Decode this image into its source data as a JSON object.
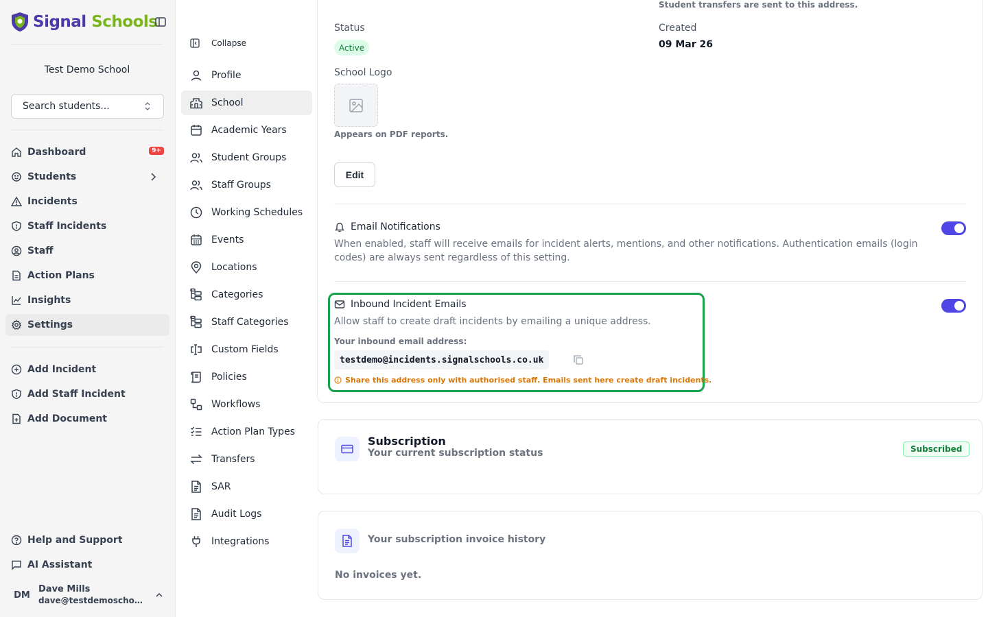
{
  "brand": {
    "name_part1": "Signal",
    "name_part2": " Schools",
    "primary": "#4b3ba8",
    "secondary": "#7ab51d"
  },
  "sidebar": {
    "school_name": "Test Demo School",
    "search_placeholder": "Search students...",
    "main_items": [
      {
        "label": "Dashboard",
        "icon": "home-icon",
        "badge": "9+"
      },
      {
        "label": "Students",
        "icon": "smile-icon"
      },
      {
        "label": "Incidents",
        "icon": "warning-triangle-icon"
      },
      {
        "label": "Staff Incidents",
        "icon": "shield-icon"
      },
      {
        "label": "Staff",
        "icon": "user-circle-icon"
      },
      {
        "label": "Action Plans",
        "icon": "document-icon"
      },
      {
        "label": "Insights",
        "icon": "line-chart-icon"
      },
      {
        "label": "Settings",
        "icon": "gear-icon",
        "active": true
      }
    ],
    "quick_items": [
      {
        "label": "Add Incident",
        "icon": "plus-circle-icon"
      },
      {
        "label": "Add Staff Incident",
        "icon": "shield-plus-icon"
      },
      {
        "label": "Add Document",
        "icon": "file-plus-icon"
      }
    ],
    "footer_items": [
      {
        "label": "Help and Support",
        "icon": "help-circle-icon"
      },
      {
        "label": "AI Assistant",
        "icon": "chat-bubble-icon"
      }
    ],
    "user": {
      "initials": "DM",
      "name": "Dave Mills",
      "email": "dave@testdemoschool.co.uk"
    }
  },
  "settings_nav": {
    "collapse_label": "Collapse",
    "items": [
      {
        "label": "Profile",
        "icon": "user-icon"
      },
      {
        "label": "School",
        "icon": "building-icon",
        "active": true
      },
      {
        "label": "Academic Years",
        "icon": "calendar-icon"
      },
      {
        "label": "Student Groups",
        "icon": "users-icon"
      },
      {
        "label": "Staff Groups",
        "icon": "users-cog-icon"
      },
      {
        "label": "Working Schedules",
        "icon": "clock-icon"
      },
      {
        "label": "Events",
        "icon": "calendar-days-icon"
      },
      {
        "label": "Locations",
        "icon": "map-pin-icon"
      },
      {
        "label": "Categories",
        "icon": "folder-tree-icon"
      },
      {
        "label": "Staff Categories",
        "icon": "folder-tree-icon"
      },
      {
        "label": "Custom Fields",
        "icon": "text-cursor-input-icon"
      },
      {
        "label": "Policies",
        "icon": "scroll-icon"
      },
      {
        "label": "Workflows",
        "icon": "workflow-icon"
      },
      {
        "label": "Action Plan Types",
        "icon": "list-checks-icon"
      },
      {
        "label": "Transfers",
        "icon": "arrows-left-right-icon"
      },
      {
        "label": "SAR",
        "icon": "file-text-icon"
      },
      {
        "label": "Audit Logs",
        "icon": "file-search-icon"
      },
      {
        "label": "Integrations",
        "icon": "plug-icon"
      }
    ]
  },
  "school_card": {
    "transfer_note": "Student transfers are sent to this address.",
    "status_label": "Status",
    "status_value": "Active",
    "created_label": "Created",
    "created_value": "09 Mar 26",
    "logo_label": "School Logo",
    "logo_hint": "Appears on PDF reports.",
    "edit_label": "Edit",
    "email_notifications": {
      "title": "Email Notifications",
      "description": "When enabled, staff will receive emails for incident alerts, mentions, and other notifications. Authentication emails (login codes) are always sent regardless of this setting.",
      "enabled": true
    },
    "inbound_emails": {
      "title": "Inbound Incident Emails",
      "description": "Allow staff to create draft incidents by emailing a unique address.",
      "address_label": "Your inbound email address:",
      "address": "testdemo@incidents.signalschools.co.uk",
      "warning": "Share this address only with authorised staff. Emails sent here create draft incidents.",
      "enabled": true
    }
  },
  "subscription_card": {
    "title": "Subscription",
    "subtitle": "Your current subscription status",
    "badge": "Subscribed"
  },
  "invoice_card": {
    "title": "Your subscription invoice history",
    "empty": "No invoices yet."
  }
}
